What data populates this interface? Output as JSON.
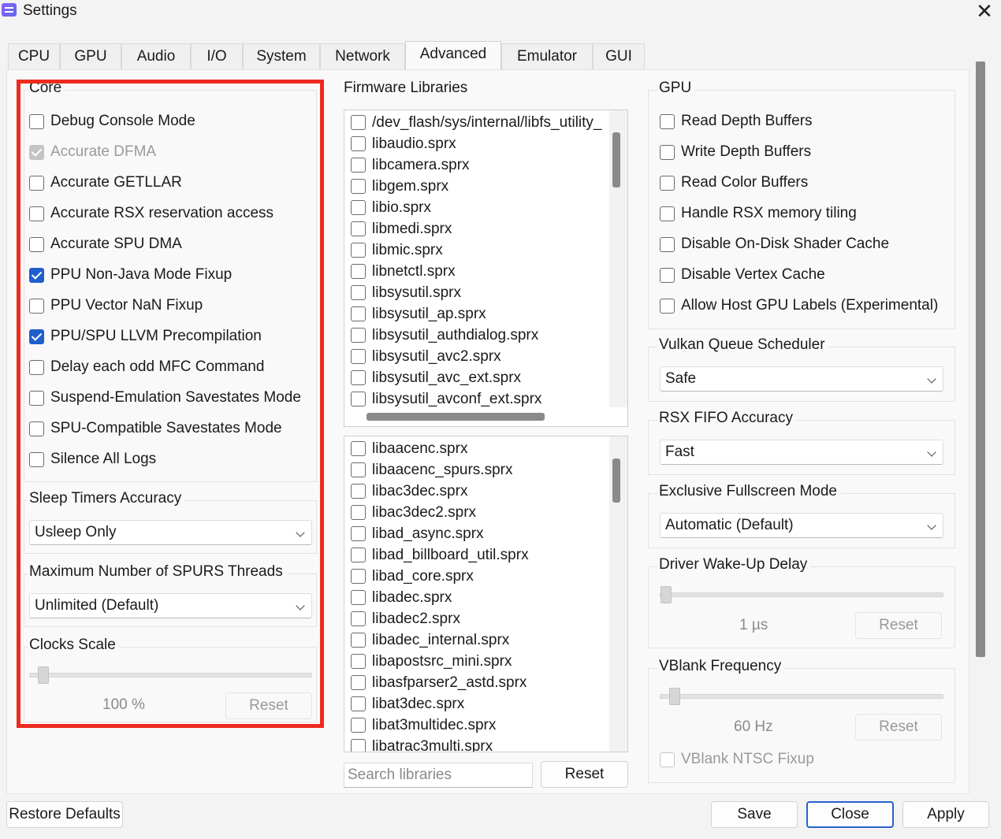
{
  "window": {
    "title": "Settings",
    "close_glyph": "✕"
  },
  "tabs": [
    "CPU",
    "GPU",
    "Audio",
    "I/O",
    "System",
    "Network",
    "Advanced",
    "Emulator",
    "GUI"
  ],
  "active_tab": "Advanced",
  "core": {
    "title": "Core",
    "options": [
      {
        "label": "Debug Console Mode",
        "checked": false
      },
      {
        "label": "Accurate DFMA",
        "checked": true,
        "disabled": true
      },
      {
        "label": "Accurate GETLLAR",
        "checked": false
      },
      {
        "label": "Accurate RSX reservation access",
        "checked": false
      },
      {
        "label": "Accurate SPU DMA",
        "checked": false
      },
      {
        "label": "PPU Non-Java Mode Fixup",
        "checked": true
      },
      {
        "label": "PPU Vector NaN Fixup",
        "checked": false
      },
      {
        "label": "PPU/SPU LLVM Precompilation",
        "checked": true
      },
      {
        "label": "Delay each odd MFC Command",
        "checked": false
      },
      {
        "label": "Suspend-Emulation Savestates Mode",
        "checked": false
      },
      {
        "label": "SPU-Compatible Savestates Mode",
        "checked": false
      },
      {
        "label": "Silence All Logs",
        "checked": false
      }
    ]
  },
  "sleep_timers": {
    "title": "Sleep Timers Accuracy",
    "value": "Usleep Only"
  },
  "spurs_threads": {
    "title": "Maximum Number of SPURS Threads",
    "value": "Unlimited (Default)"
  },
  "clocks_scale": {
    "title": "Clocks Scale",
    "value_text": "100 %",
    "reset_label": "Reset",
    "level": 0.03
  },
  "firmware": {
    "title": "Firmware Libraries",
    "list1": [
      "/dev_flash/sys/internal/libfs_utility_",
      "libaudio.sprx",
      "libcamera.sprx",
      "libgem.sprx",
      "libio.sprx",
      "libmedi.sprx",
      "libmic.sprx",
      "libnetctl.sprx",
      "libsysutil.sprx",
      "libsysutil_ap.sprx",
      "libsysutil_authdialog.sprx",
      "libsysutil_avc2.sprx",
      "libsysutil_avc_ext.sprx",
      "libsysutil_avconf_ext.sprx"
    ],
    "list2": [
      "libaacenc.sprx",
      "libaacenc_spurs.sprx",
      "libac3dec.sprx",
      "libac3dec2.sprx",
      "libad_async.sprx",
      "libad_billboard_util.sprx",
      "libad_core.sprx",
      "libadec.sprx",
      "libadec2.sprx",
      "libadec_internal.sprx",
      "libapostsrc_mini.sprx",
      "libasfparser2_astd.sprx",
      "libat3dec.sprx",
      "libat3multidec.sprx",
      "libatrac3multi.sprx"
    ],
    "search_placeholder": "Search libraries",
    "reset_label": "Reset"
  },
  "gpu": {
    "title": "GPU",
    "options": [
      {
        "label": "Read Depth Buffers",
        "checked": false
      },
      {
        "label": "Write Depth Buffers",
        "checked": false
      },
      {
        "label": "Read Color Buffers",
        "checked": false
      },
      {
        "label": "Handle RSX memory tiling",
        "checked": false
      },
      {
        "label": "Disable On-Disk Shader Cache",
        "checked": false
      },
      {
        "label": "Disable Vertex Cache",
        "checked": false
      },
      {
        "label": "Allow Host GPU Labels (Experimental)",
        "checked": false
      }
    ]
  },
  "vulkan_queue": {
    "title": "Vulkan Queue Scheduler",
    "value": "Safe"
  },
  "rsx_fifo": {
    "title": "RSX FIFO Accuracy",
    "value": "Fast"
  },
  "fullscreen": {
    "title": "Exclusive Fullscreen Mode",
    "value": "Automatic (Default)"
  },
  "wakeup": {
    "title": "Driver Wake-Up Delay",
    "value_text": "1 µs",
    "reset_label": "Reset",
    "level": 0.0
  },
  "vblank": {
    "title": "VBlank Frequency",
    "value_text": "60 Hz",
    "reset_label": "Reset",
    "ntsc_label": "VBlank NTSC Fixup",
    "level": 0.03
  },
  "footer": {
    "restore_label": "Restore Defaults",
    "save_label": "Save",
    "close_label": "Close",
    "apply_label": "Apply"
  },
  "colors": {
    "accent": "#1f5fcc",
    "highlight": "#ee2b1e"
  }
}
